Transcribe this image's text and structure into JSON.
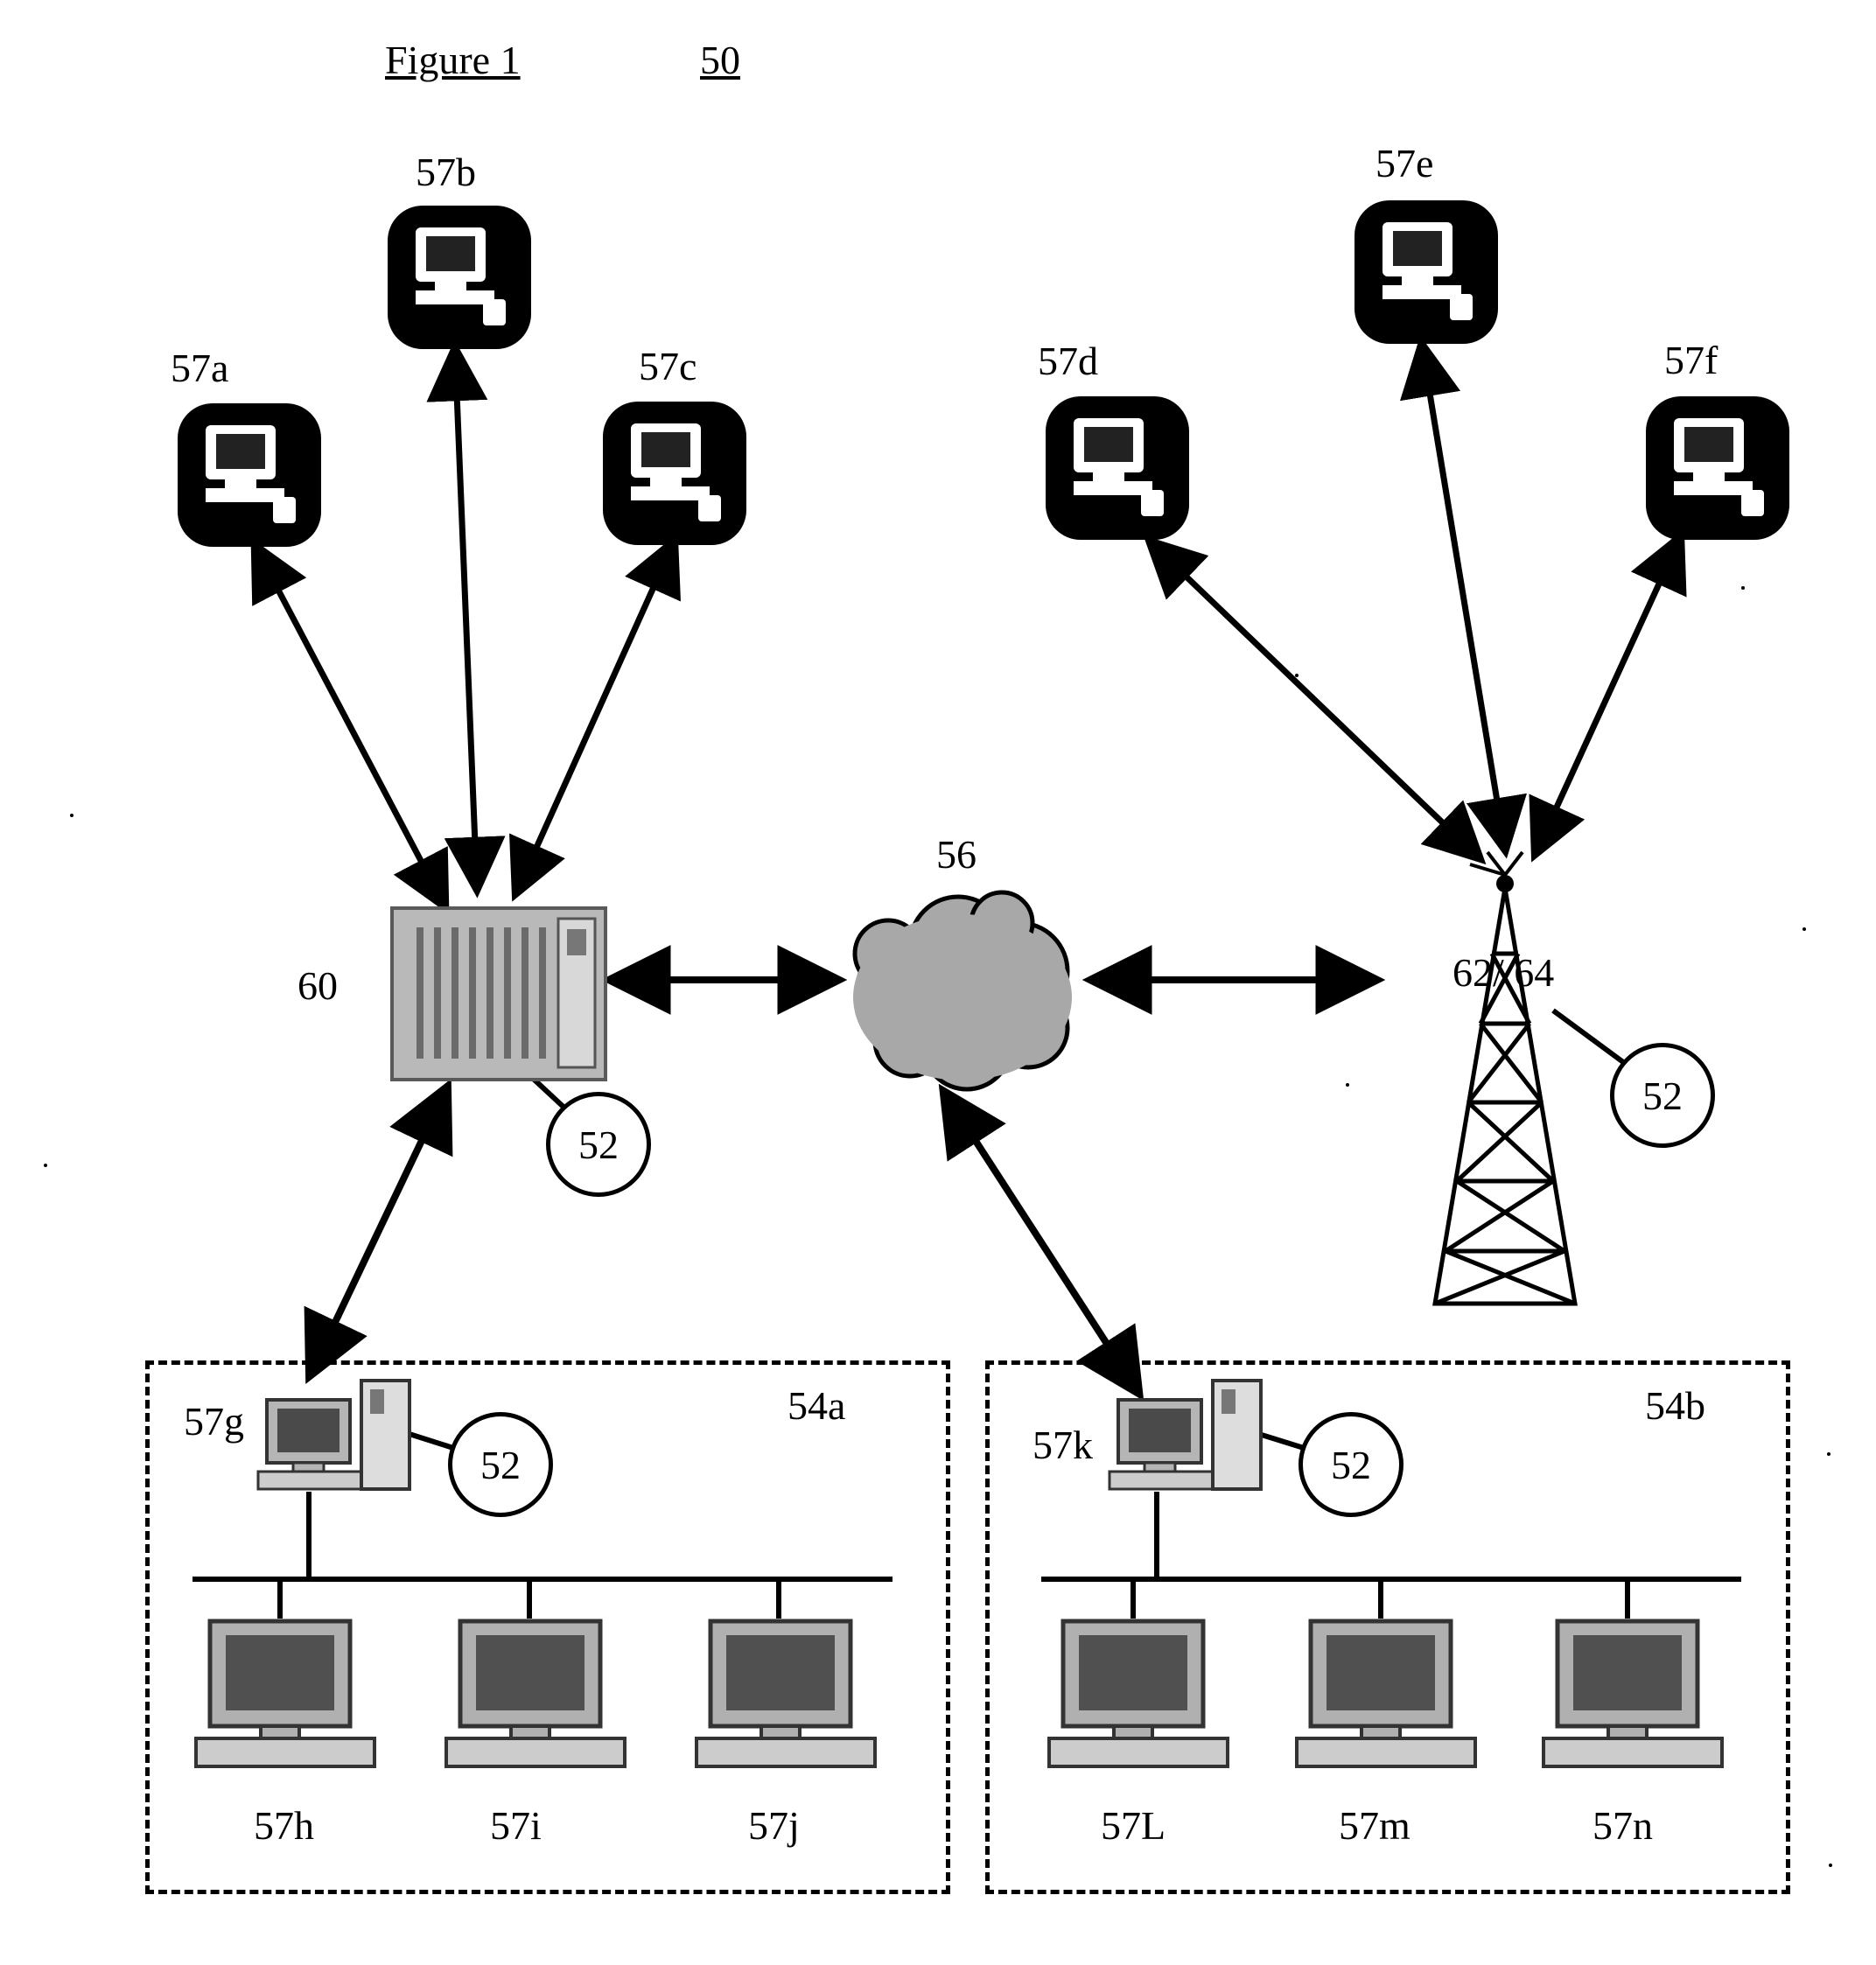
{
  "title": "Figure 1",
  "figure_number": "50",
  "nodes": {
    "terminal_a": "57a",
    "terminal_b": "57b",
    "terminal_c": "57c",
    "terminal_d": "57d",
    "terminal_e": "57e",
    "terminal_f": "57f",
    "terminal_g": "57g",
    "terminal_h": "57h",
    "terminal_i": "57i",
    "terminal_j": "57j",
    "terminal_k": "57k",
    "terminal_l": "57L",
    "terminal_m": "57m",
    "terminal_n": "57n",
    "hub": "60",
    "cloud": "56",
    "tower": "62/ 64",
    "ref_52": "52",
    "lan_a": "54a",
    "lan_b": "54b"
  }
}
